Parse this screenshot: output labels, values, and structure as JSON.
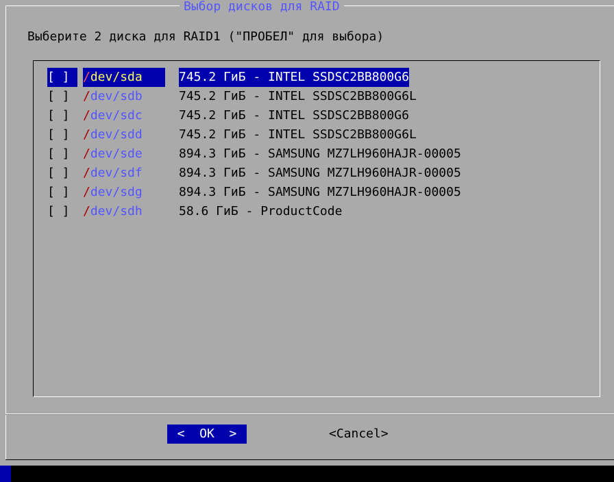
{
  "dialog": {
    "title": "Выбор дисков для RAID",
    "prompt": "Выберите 2 диска для RAID1 (\"ПРОБЕЛ\" для выбора)"
  },
  "disks": [
    {
      "check": "[ ]",
      "slash": "/",
      "name": "dev/sda",
      "desc": "745.2 ГиБ - INTEL SSDSC2BB800G6",
      "selected": true
    },
    {
      "check": "[ ]",
      "slash": "/",
      "name": "dev/sdb",
      "desc": "745.2 ГиБ - INTEL SSDSC2BB800G6L"
    },
    {
      "check": "[ ]",
      "slash": "/",
      "name": "dev/sdc",
      "desc": "745.2 ГиБ - INTEL SSDSC2BB800G6"
    },
    {
      "check": "[ ]",
      "slash": "/",
      "name": "dev/sdd",
      "desc": "745.2 ГиБ - INTEL SSDSC2BB800G6L"
    },
    {
      "check": "[ ]",
      "slash": "/",
      "name": "dev/sde",
      "desc": "894.3 ГиБ - SAMSUNG MZ7LH960HAJR-00005"
    },
    {
      "check": "[ ]",
      "slash": "/",
      "name": "dev/sdf",
      "desc": "894.3 ГиБ - SAMSUNG MZ7LH960HAJR-00005"
    },
    {
      "check": "[ ]",
      "slash": "/",
      "name": "dev/sdg",
      "desc": "894.3 ГиБ - SAMSUNG MZ7LH960HAJR-00005"
    },
    {
      "check": "[ ]",
      "slash": "/",
      "name": "dev/sdh",
      "desc": "58.6 ГиБ - ProductCode"
    }
  ],
  "buttons": {
    "ok": "<  OK  >",
    "cancel": "<Cancel>"
  },
  "colors": {
    "screen_bg": "#0000ac",
    "dialog_bg": "#aaaaaa",
    "highlight_bg": "#0000ac",
    "device_name": "#5555ff",
    "device_slash": "#aa0000",
    "selected_name": "#ffff55"
  }
}
